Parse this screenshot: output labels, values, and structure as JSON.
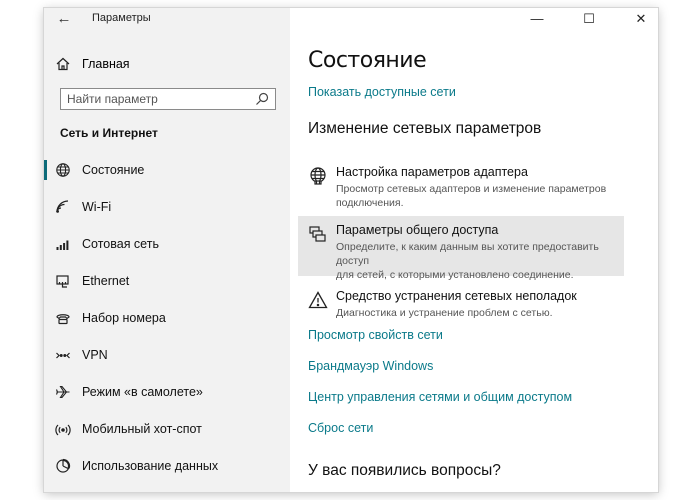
{
  "window": {
    "title": "Параметры",
    "back_symbol": "←",
    "controls": {
      "minimize": "—",
      "maximize": "☐",
      "close": "✕"
    }
  },
  "sidebar": {
    "home_label": "Главная",
    "search": {
      "placeholder": "Найти параметр",
      "value": ""
    },
    "section_title": "Сеть и Интернет",
    "items": [
      {
        "label": "Состояние",
        "icon": "globe-icon",
        "active": true
      },
      {
        "label": "Wi-Fi",
        "icon": "wifi-icon"
      },
      {
        "label": "Сотовая сеть",
        "icon": "cellular-icon"
      },
      {
        "label": "Ethernet",
        "icon": "ethernet-icon"
      },
      {
        "label": "Набор номера",
        "icon": "dialup-icon"
      },
      {
        "label": "VPN",
        "icon": "vpn-icon"
      },
      {
        "label": "Режим «в самолете»",
        "icon": "airplane-icon"
      },
      {
        "label": "Мобильный хот-спот",
        "icon": "hotspot-icon"
      },
      {
        "label": "Использование данных",
        "icon": "data-usage-icon"
      }
    ]
  },
  "main": {
    "title": "Состояние",
    "show_networks": "Показать доступные сети",
    "change_header": "Изменение сетевых параметров",
    "settings": [
      {
        "title": "Настройка параметров адаптера",
        "desc_lines": [
          "Просмотр сетевых адаптеров и изменение параметров",
          "подключения."
        ],
        "icon": "adapter-icon"
      },
      {
        "title": "Параметры общего доступа",
        "desc_lines": [
          "Определите, к каким данным вы хотите предоставить доступ",
          "для сетей, с которыми установлено соединение."
        ],
        "icon": "sharing-icon",
        "highlighted": true
      },
      {
        "title": "Средство устранения сетевых неполадок",
        "desc_lines": [
          "Диагностика и устранение проблем с сетью."
        ],
        "icon": "warning-icon"
      }
    ],
    "links": [
      "Просмотр свойств сети",
      "Брандмауэр Windows",
      "Центр управления сетями и общим доступом",
      "Сброс сети"
    ],
    "questions_header": "У вас появились вопросы?"
  },
  "colors": {
    "accent": "#0b6a79",
    "link": "#0b7a8a",
    "sidebar_bg": "#f2f2f2",
    "highlight_bg": "#e6e6e6"
  }
}
